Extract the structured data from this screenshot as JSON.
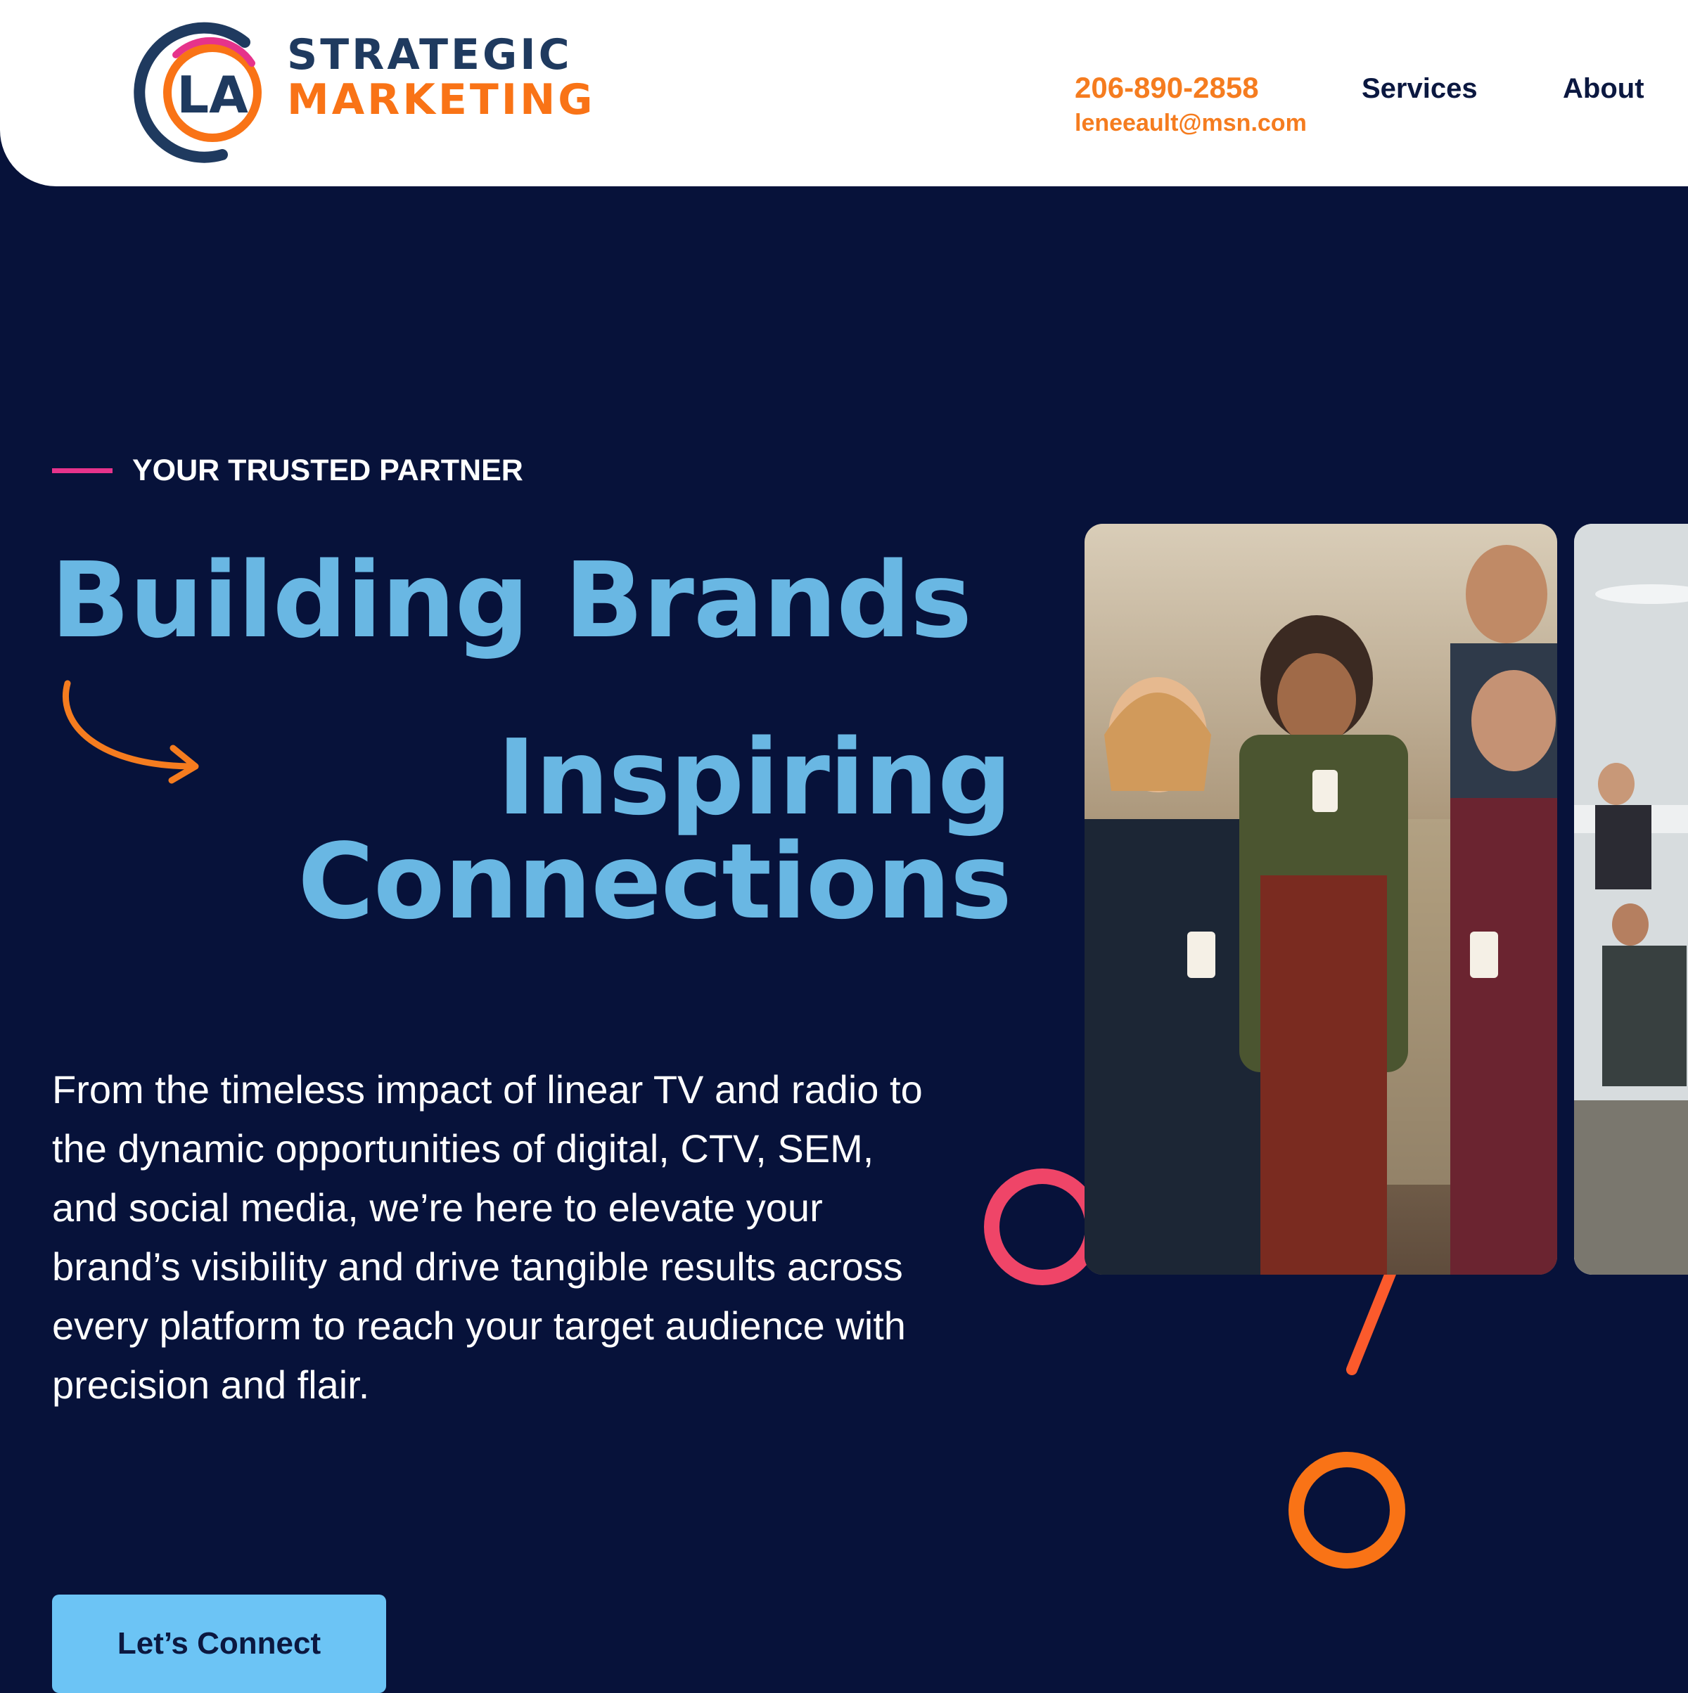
{
  "brand": {
    "line1": "STRATEGIC",
    "line2": "MARKETING",
    "colors": {
      "navy": "#1f3a5f",
      "orange": "#f97316",
      "pink": "#e6338b"
    }
  },
  "header": {
    "phone": "206-890-2858",
    "email": "leneeault@msn.com",
    "nav": {
      "services": "Services",
      "about": "About"
    }
  },
  "hero": {
    "eyebrow": "YOUR TRUSTED PARTNER",
    "headline_line1": "Building Brands",
    "headline_line2": "Inspiring",
    "headline_line3": "Connections",
    "body": "From the timeless impact of linear TV and radio to the dynamic opportunities of digital, CTV, SEM, and social media, we’re here to elevate your brand’s visibility and drive tangible results across every platform to reach your target audience with precision and flair.",
    "cta": "Let’s Connect"
  },
  "theme": {
    "background": "#07123a",
    "headline_color": "#69b7e3",
    "cta_color": "#6cc4f5",
    "accent_orange": "#f57c1f"
  }
}
